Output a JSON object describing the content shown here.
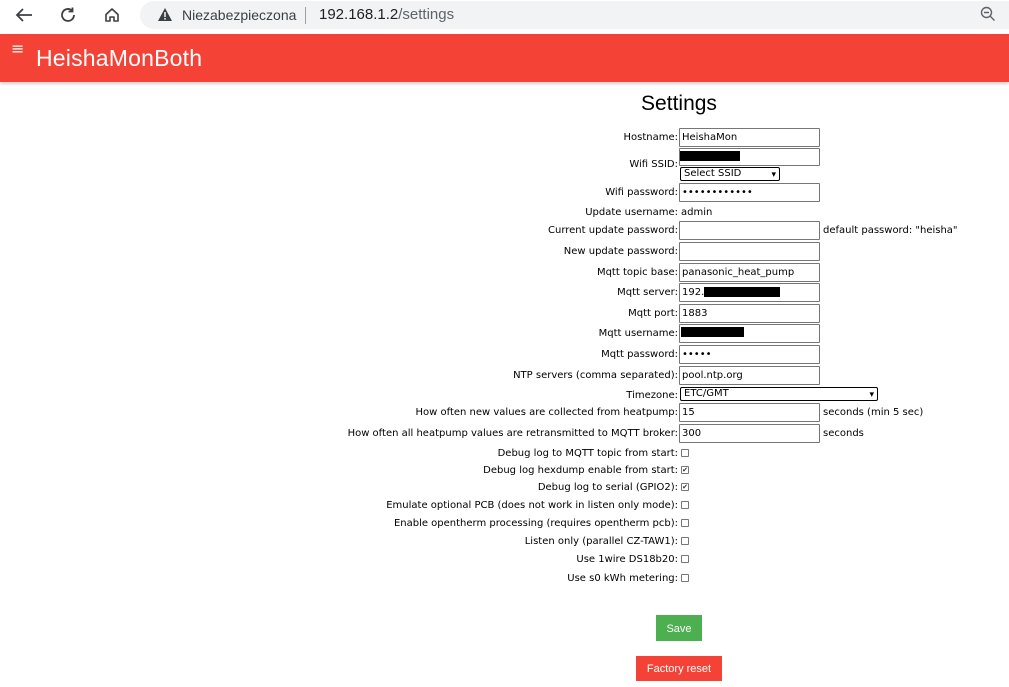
{
  "browser": {
    "security_label": "Niezabezpieczona",
    "url_host": "192.168.1.2",
    "url_path": "/settings"
  },
  "app": {
    "title": "HeishaMonBoth",
    "menu_icon": "≡"
  },
  "settings": {
    "title": "Settings",
    "hostname": {
      "label": "Hostname:",
      "value": "HeishaMon"
    },
    "wifi_ssid": {
      "label": "Wifi SSID:",
      "select_value": "Select SSID"
    },
    "wifi_password": {
      "label": "Wifi password:",
      "value": "••••••••••••"
    },
    "update_username": {
      "label": "Update username:",
      "value": "admin"
    },
    "current_update_password": {
      "label": "Current update password:",
      "value": "",
      "note": "default password: \"heisha\""
    },
    "new_update_password": {
      "label": "New update password:",
      "value": ""
    },
    "mqtt_topic_base": {
      "label": "Mqtt topic base:",
      "value": "panasonic_heat_pump"
    },
    "mqtt_server": {
      "label": "Mqtt server:",
      "value": "192."
    },
    "mqtt_port": {
      "label": "Mqtt port:",
      "value": "1883"
    },
    "mqtt_username": {
      "label": "Mqtt username:",
      "value": ""
    },
    "mqtt_password": {
      "label": "Mqtt password:",
      "value": "•••••"
    },
    "ntp_servers": {
      "label": "NTP servers (comma separated):",
      "value": "pool.ntp.org"
    },
    "timezone": {
      "label": "Timezone:",
      "value": "ETC/GMT"
    },
    "collect_interval": {
      "label": "How often new values are collected from heatpump:",
      "value": "15",
      "note": "seconds (min 5 sec)"
    },
    "retransmit_interval": {
      "label": "How often all heatpump values are retransmitted to MQTT broker:",
      "value": "300",
      "note": "seconds"
    },
    "checkboxes": [
      {
        "label": "Debug log to MQTT topic from start:",
        "checked": false
      },
      {
        "label": "Debug log hexdump enable from start:",
        "checked": true
      },
      {
        "label": "Debug log to serial (GPIO2):",
        "checked": true
      },
      {
        "label": "Emulate optional PCB (does not work in listen only mode):",
        "checked": false
      },
      {
        "label": "Enable opentherm processing (requires opentherm pcb):",
        "checked": false
      },
      {
        "label": "Listen only (parallel CZ-TAW1):",
        "checked": false
      },
      {
        "label": "Use 1wire DS18b20:",
        "checked": false
      },
      {
        "label": "Use s0 kWh metering:",
        "checked": false
      }
    ],
    "save_label": "Save",
    "factory_reset_label": "Factory reset"
  },
  "colors": {
    "header": "#f44336",
    "save": "#4caf50",
    "factory_reset": "#f44336"
  },
  "icons": [
    "back-arrow-icon",
    "reload-icon",
    "home-icon",
    "warning-icon",
    "zoom-out-icon",
    "hamburger-menu-icon"
  ]
}
